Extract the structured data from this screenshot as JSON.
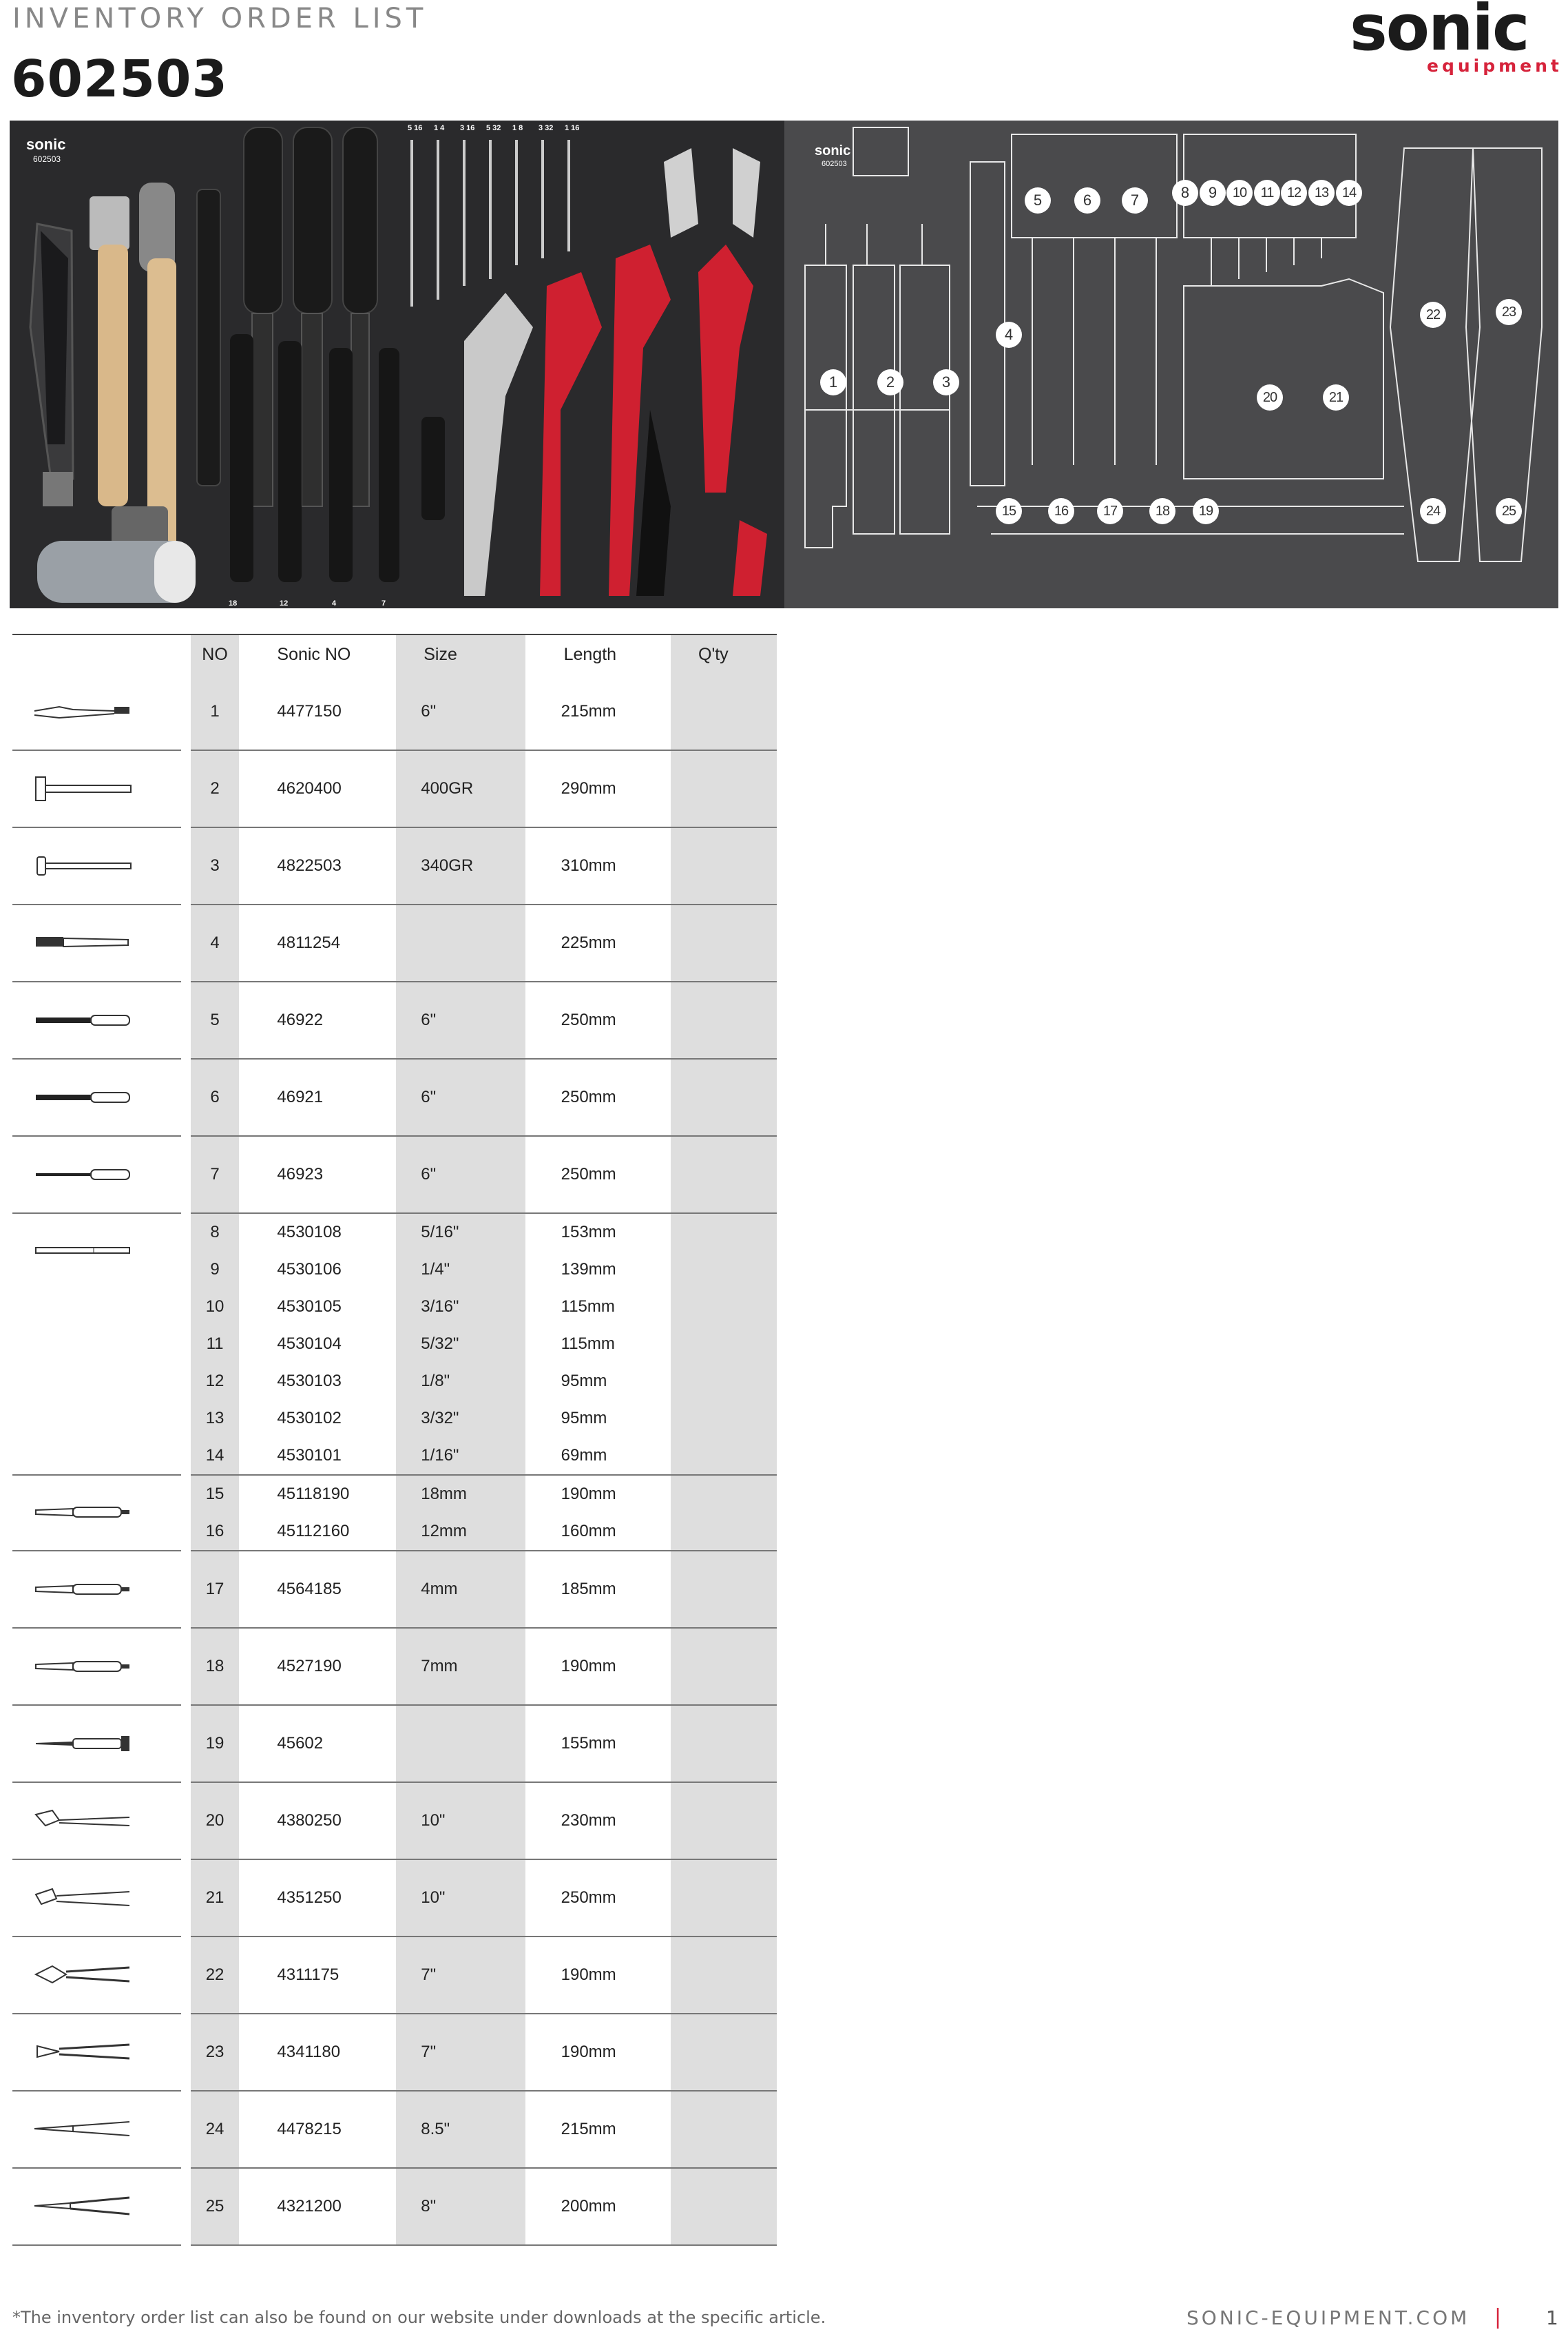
{
  "header": {
    "label": "INVENTORY ORDER LIST",
    "article_no": "602503",
    "logo_text": "sonic",
    "logo_sub": "equipment"
  },
  "photo": {
    "brand": "sonic",
    "code": "602503",
    "top_marks": [
      "5 16",
      "1 4",
      "3 16",
      "5 32",
      "1 8",
      "3 32",
      "1 16"
    ],
    "bottom_marks": [
      "18",
      "12",
      "4",
      "7"
    ]
  },
  "layout": {
    "brand": "sonic",
    "code": "602503",
    "badges": [
      "1",
      "2",
      "3",
      "4",
      "5",
      "6",
      "7",
      "8",
      "9",
      "10",
      "11",
      "12",
      "13",
      "14",
      "15",
      "16",
      "17",
      "18",
      "19",
      "20",
      "21",
      "22",
      "23",
      "24",
      "25"
    ]
  },
  "table": {
    "headers": [
      "NO",
      "Sonic NO",
      "Size",
      "Length",
      "Q'ty"
    ],
    "rows": [
      {
        "no": "1",
        "sn": "4477150",
        "size": "6\"",
        "len": "215mm"
      },
      {
        "no": "2",
        "sn": "4620400",
        "size": "400GR",
        "len": "290mm"
      },
      {
        "no": "3",
        "sn": "4822503",
        "size": "340GR",
        "len": "310mm"
      },
      {
        "no": "4",
        "sn": "4811254",
        "size": "",
        "len": "225mm"
      },
      {
        "no": "5",
        "sn": "46922",
        "size": "6\"",
        "len": "250mm"
      },
      {
        "no": "6",
        "sn": "46921",
        "size": "6\"",
        "len": "250mm"
      },
      {
        "no": "7",
        "sn": "46923",
        "size": "6\"",
        "len": "250mm"
      },
      {
        "no": "8",
        "sn": "4530108",
        "size": "5/16\"",
        "len": "153mm"
      },
      {
        "no": "9",
        "sn": "4530106",
        "size": "1/4\"",
        "len": "139mm"
      },
      {
        "no": "10",
        "sn": "4530105",
        "size": "3/16\"",
        "len": "115mm"
      },
      {
        "no": "11",
        "sn": "4530104",
        "size": "5/32\"",
        "len": "115mm"
      },
      {
        "no": "12",
        "sn": "4530103",
        "size": "1/8\"",
        "len": "95mm"
      },
      {
        "no": "13",
        "sn": "4530102",
        "size": "3/32\"",
        "len": "95mm"
      },
      {
        "no": "14",
        "sn": "4530101",
        "size": "1/16\"",
        "len": "69mm"
      },
      {
        "no": "15",
        "sn": "45118190",
        "size": "18mm",
        "len": "190mm"
      },
      {
        "no": "16",
        "sn": "45112160",
        "size": "12mm",
        "len": "160mm"
      },
      {
        "no": "17",
        "sn": "4564185",
        "size": "4mm",
        "len": "185mm"
      },
      {
        "no": "18",
        "sn": "4527190",
        "size": "7mm",
        "len": "190mm"
      },
      {
        "no": "19",
        "sn": "45602",
        "size": "",
        "len": "155mm"
      },
      {
        "no": "20",
        "sn": "4380250",
        "size": "10\"",
        "len": "230mm"
      },
      {
        "no": "21",
        "sn": "4351250",
        "size": "10\"",
        "len": "250mm"
      },
      {
        "no": "22",
        "sn": "4311175",
        "size": "7\"",
        "len": "190mm"
      },
      {
        "no": "23",
        "sn": "4341180",
        "size": "7\"",
        "len": "190mm"
      },
      {
        "no": "24",
        "sn": "4478215",
        "size": "8.5\"",
        "len": "215mm"
      },
      {
        "no": "25",
        "sn": "4321200",
        "size": "8\"",
        "len": "200mm"
      }
    ]
  },
  "footer": {
    "note": "*The inventory order list can also be found on our website under downloads at the specific article.",
    "website": "SONIC-EQUIPMENT.COM",
    "separator": "|",
    "page": "1"
  },
  "colors": {
    "brand_red": "#d6233b",
    "dark": "#1b1b1b",
    "zebra": "#dedede",
    "foam": "#4a4a4c"
  }
}
